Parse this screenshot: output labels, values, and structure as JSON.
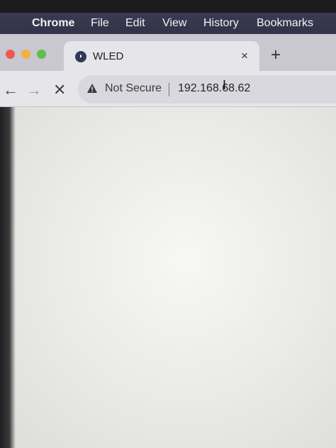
{
  "menubar": {
    "app_name": "Chrome",
    "items": [
      "File",
      "Edit",
      "View",
      "History",
      "Bookmarks"
    ]
  },
  "tab": {
    "title": "WLED",
    "close_glyph": "×",
    "new_tab_glyph": "+"
  },
  "toolbar": {
    "back_glyph": "←",
    "forward_glyph": "→",
    "stop_glyph": "✕"
  },
  "address": {
    "security_label": "Not Secure",
    "url": "192.168.68.62"
  },
  "colors": {
    "close_dot": "#ee5a52",
    "minimize_dot": "#f1b33c",
    "zoom_dot": "#5cc14a"
  }
}
